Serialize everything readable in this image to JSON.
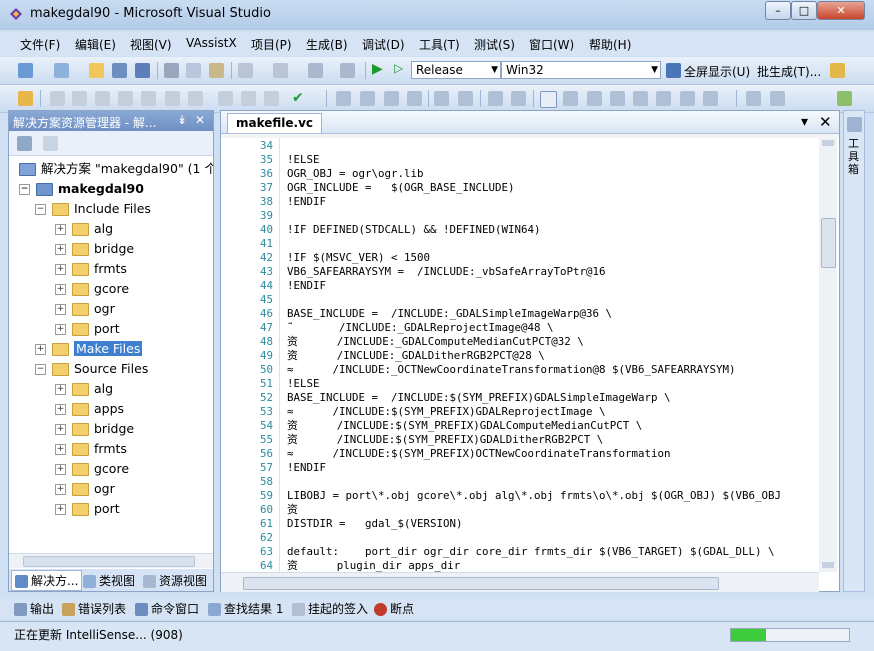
{
  "window": {
    "title": "makegdal90 - Microsoft Visual Studio",
    "controls": {
      "minimize": "–",
      "maximize": "□",
      "close": "✕"
    }
  },
  "menu": [
    "文件(F)",
    "编辑(E)",
    "视图(V)",
    "VAssistX",
    "项目(P)",
    "生成(B)",
    "调试(D)",
    "工具(T)",
    "测试(S)",
    "窗口(W)",
    "帮助(H)"
  ],
  "toolbar": {
    "configuration": "Release",
    "platform": "Win32",
    "fullscreen_label": "全屏显示(U)",
    "batch_build_label": "批生成(T)..."
  },
  "solution_explorer": {
    "title": "解决方案资源管理器 - 解...",
    "pin": "↡",
    "close": "✕",
    "solution_label": "解决方案 \"makegdal90\" (1 个项",
    "project_label": "makegdal90",
    "items": [
      {
        "label": "Include Files",
        "depth": 2,
        "expander": "−",
        "selected": false
      },
      {
        "label": "alg",
        "depth": 3,
        "expander": "+",
        "selected": false
      },
      {
        "label": "bridge",
        "depth": 3,
        "expander": "+",
        "selected": false
      },
      {
        "label": "frmts",
        "depth": 3,
        "expander": "+",
        "selected": false
      },
      {
        "label": "gcore",
        "depth": 3,
        "expander": "+",
        "selected": false
      },
      {
        "label": "ogr",
        "depth": 3,
        "expander": "+",
        "selected": false
      },
      {
        "label": "port",
        "depth": 3,
        "expander": "+",
        "selected": false
      },
      {
        "label": "Make Files",
        "depth": 2,
        "expander": "+",
        "selected": true
      },
      {
        "label": "Source Files",
        "depth": 2,
        "expander": "−",
        "selected": false
      },
      {
        "label": "alg",
        "depth": 3,
        "expander": "+",
        "selected": false
      },
      {
        "label": "apps",
        "depth": 3,
        "expander": "+",
        "selected": false
      },
      {
        "label": "bridge",
        "depth": 3,
        "expander": "+",
        "selected": false
      },
      {
        "label": "frmts",
        "depth": 3,
        "expander": "+",
        "selected": false
      },
      {
        "label": "gcore",
        "depth": 3,
        "expander": "+",
        "selected": false
      },
      {
        "label": "ogr",
        "depth": 3,
        "expander": "+",
        "selected": false
      },
      {
        "label": "port",
        "depth": 3,
        "expander": "+",
        "selected": false
      }
    ],
    "tabs": [
      "解决方...",
      "类视图",
      "资源视图"
    ]
  },
  "editor": {
    "tab_label": "makefile.vc",
    "dropdown": "▾",
    "close": "✕",
    "lines": [
      {
        "n": "34",
        "t": ""
      },
      {
        "n": "35",
        "t": "!ELSE"
      },
      {
        "n": "36",
        "t": "OGR_OBJ = ogr\\ogr.lib"
      },
      {
        "n": "37",
        "t": "OGR_INCLUDE =   $(OGR_BASE_INCLUDE)"
      },
      {
        "n": "38",
        "t": "!ENDIF"
      },
      {
        "n": "39",
        "t": ""
      },
      {
        "n": "40",
        "t": "!IF DEFINED(STDCALL) && !DEFINED(WIN64)"
      },
      {
        "n": "41",
        "t": ""
      },
      {
        "n": "42",
        "t": "!IF $(MSVC_VER) < 1500"
      },
      {
        "n": "43",
        "t": "VB6_SAFEARRAYSYM =  /INCLUDE:_vbSafeArrayToPtr@16"
      },
      {
        "n": "44",
        "t": "!ENDIF"
      },
      {
        "n": "45",
        "t": ""
      },
      {
        "n": "46",
        "t": "BASE_INCLUDE =  /INCLUDE:_GDALSimpleImageWarp@36 \\"
      },
      {
        "n": "47",
        "t": "˜       /INCLUDE:_GDALReprojectImage@48 \\"
      },
      {
        "n": "48",
        "t": "资      /INCLUDE:_GDALComputeMedianCutPCT@32 \\"
      },
      {
        "n": "49",
        "t": "资      /INCLUDE:_GDALDitherRGB2PCT@28 \\"
      },
      {
        "n": "50",
        "t": "≈      /INCLUDE:_OCTNewCoordinateTransformation@8 $(VB6_SAFEARRAYSYM)"
      },
      {
        "n": "51",
        "t": "!ELSE"
      },
      {
        "n": "52",
        "t": "BASE_INCLUDE =  /INCLUDE:$(SYM_PREFIX)GDALSimpleImageWarp \\"
      },
      {
        "n": "53",
        "t": "≈      /INCLUDE:$(SYM_PREFIX)GDALReprojectImage \\"
      },
      {
        "n": "54",
        "t": "资      /INCLUDE:$(SYM_PREFIX)GDALComputeMedianCutPCT \\"
      },
      {
        "n": "55",
        "t": "资      /INCLUDE:$(SYM_PREFIX)GDALDitherRGB2PCT \\"
      },
      {
        "n": "56",
        "t": "≈      /INCLUDE:$(SYM_PREFIX)OCTNewCoordinateTransformation"
      },
      {
        "n": "57",
        "t": "!ENDIF"
      },
      {
        "n": "58",
        "t": ""
      },
      {
        "n": "59",
        "t": "LIBOBJ = port\\*.obj gcore\\*.obj alg\\*.obj frmts\\o\\*.obj $(OGR_OBJ) $(VB6_OBJ"
      },
      {
        "n": "60",
        "t": "资"
      },
      {
        "n": "61",
        "t": "DISTDIR =   gdal_$(VERSION)"
      },
      {
        "n": "62",
        "t": ""
      },
      {
        "n": "63",
        "t": "default:    port_dir ogr_dir core_dir frmts_dir $(VB6_TARGET) $(GDAL_DLL) \\"
      },
      {
        "n": "64",
        "t": "资      plugin_dir apps_dir"
      }
    ]
  },
  "right_strip_label": "工具箱",
  "bottom_tabs": [
    "输出",
    "错误列表",
    "命令窗口",
    "查找结果 1",
    "挂起的签入",
    "断点"
  ],
  "status": {
    "text": "正在更新 IntelliSense... (908)",
    "progress": 0.3
  },
  "colors": {
    "line_number": "#2a8ba0",
    "selection": "#3e7fd0",
    "progress": "#3ccc3c"
  }
}
